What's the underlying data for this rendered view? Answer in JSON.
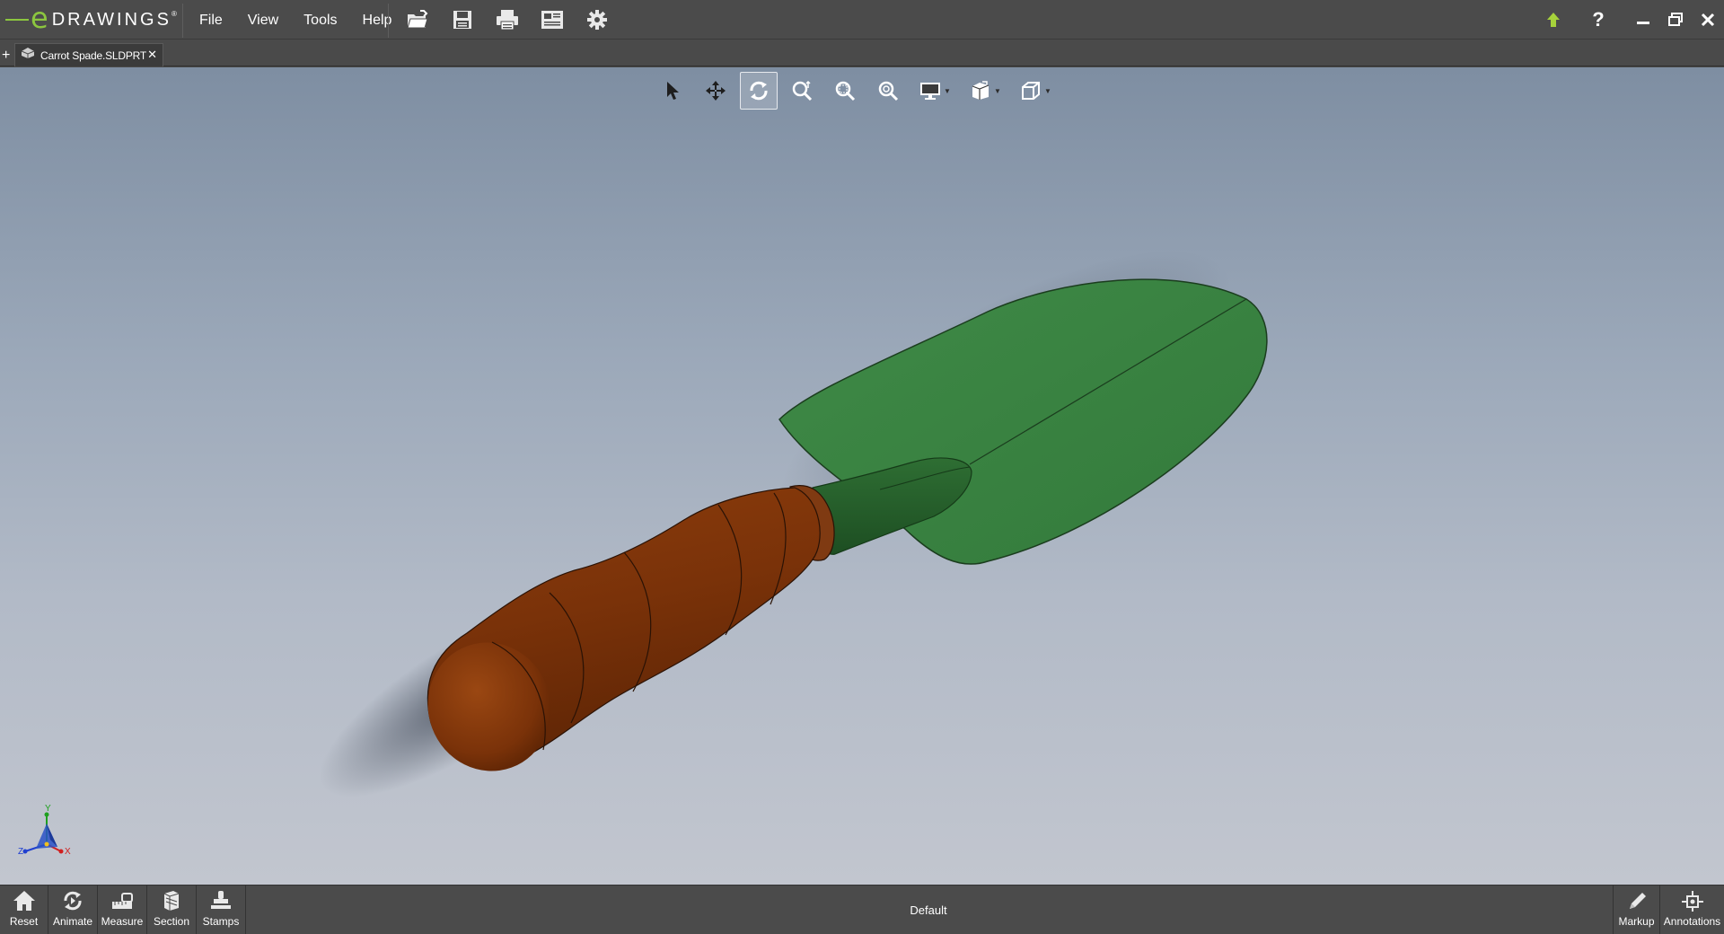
{
  "app": {
    "logo_letter": "e",
    "logo_word": "DRAWINGS",
    "logo_reg": "®"
  },
  "menu": {
    "items": [
      {
        "label": "File"
      },
      {
        "label": "View"
      },
      {
        "label": "Tools"
      },
      {
        "label": "Help"
      }
    ]
  },
  "toolbar": {
    "icons": [
      "open-icon",
      "save-icon",
      "print-icon",
      "publish-icon",
      "settings-icon"
    ]
  },
  "window_controls": {
    "icons": [
      "update-arrow-icon",
      "help-icon",
      "minimize-icon",
      "restore-icon",
      "close-icon"
    ],
    "help_glyph": "?"
  },
  "tabs": {
    "add_glyph": "+",
    "items": [
      {
        "label": "Carrot Spade.SLDPRT",
        "close_glyph": "✕"
      }
    ]
  },
  "view_toolbar": {
    "tools": [
      "select-icon",
      "pan-icon",
      "rotate-icon",
      "zoom-to-fit-icon",
      "zoom-to-area-icon",
      "zoom-in-out-icon",
      "display-style-icon",
      "hide-show-icon",
      "standard-views-icon"
    ],
    "active_tool": "rotate-icon"
  },
  "triad": {
    "x_label": "X",
    "y_label": "Y",
    "z_label": "Z"
  },
  "colors": {
    "blade_green": "#3b8442",
    "handle_brown": "#7a3209",
    "triad_x": "#d02020",
    "triad_y": "#1fa01f",
    "triad_z": "#2040d0",
    "logo_green": "#8cc63f"
  },
  "bottom_bar": {
    "left_buttons": [
      {
        "label": "Reset",
        "icon": "home-icon"
      },
      {
        "label": "Animate",
        "icon": "animate-icon"
      },
      {
        "label": "Measure",
        "icon": "measure-icon"
      },
      {
        "label": "Section",
        "icon": "section-icon"
      },
      {
        "label": "Stamps",
        "icon": "stamps-icon"
      }
    ],
    "configuration": "Default",
    "right_buttons": [
      {
        "label": "Markup",
        "icon": "markup-pencil-icon"
      },
      {
        "label": "Annotations",
        "icon": "annotations-icon"
      }
    ]
  }
}
